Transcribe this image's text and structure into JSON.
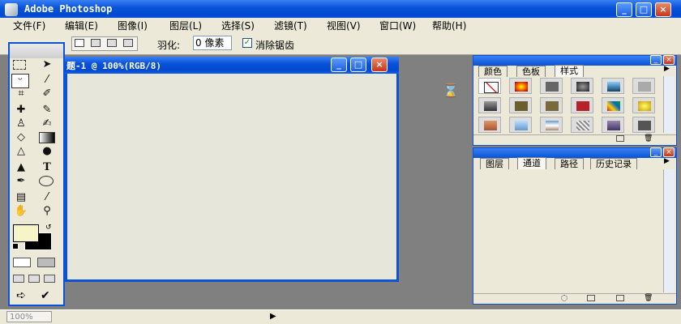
{
  "app": {
    "title": "Adobe Photoshop"
  },
  "menu": {
    "items": [
      "文件(F)",
      "编辑(E)",
      "图像(I)",
      "图层(L)",
      "选择(S)",
      "滤镜(T)",
      "视图(V)",
      "窗口(W)",
      "帮助(H)"
    ]
  },
  "options_bar": {
    "feather_label": "羽化:",
    "feather_value": "0 像素",
    "antialias_label": "消除锯齿",
    "antialias_checked": true
  },
  "document": {
    "title": "题-1 @ 100%(RGB/8)"
  },
  "styles_panel": {
    "tabs": [
      "颜色",
      "色板",
      "样式"
    ],
    "active_tab": "样式"
  },
  "layers_panel": {
    "tabs": [
      "图层",
      "通道",
      "路径",
      "历史记录"
    ],
    "active_tab": "通道"
  },
  "status": {
    "zoom": "100%"
  },
  "colors": {
    "foreground": "#f7f4c8",
    "background": "#000000",
    "title_bar": "#0a53d8",
    "workspace": "#808080"
  }
}
